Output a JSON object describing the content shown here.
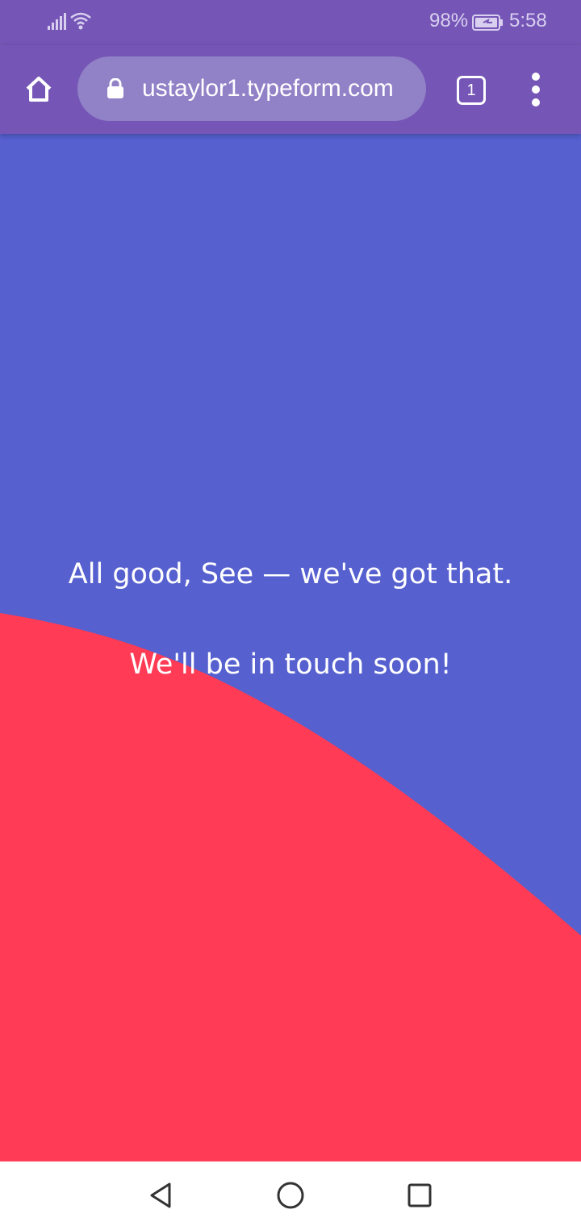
{
  "status_bar": {
    "battery": "98%",
    "time": "5:58",
    "icons": [
      "signal-icon",
      "wifi-icon",
      "battery-icon"
    ]
  },
  "browser": {
    "url": "ustaylor1.typeform.com",
    "tab_count": "1",
    "icons": [
      "home-icon",
      "lock-icon",
      "tabs-icon",
      "more-vert-icon"
    ]
  },
  "page": {
    "message_line1": "All good, See — we've got that.",
    "message_line2": "We'll be in touch soon!",
    "colors": {
      "background": "#5660cf",
      "wave": "#ff3b55",
      "toolbar": "#7556b6"
    }
  },
  "nav_bar": {
    "icons": [
      "back-icon",
      "home-circle-icon",
      "recents-icon"
    ]
  }
}
